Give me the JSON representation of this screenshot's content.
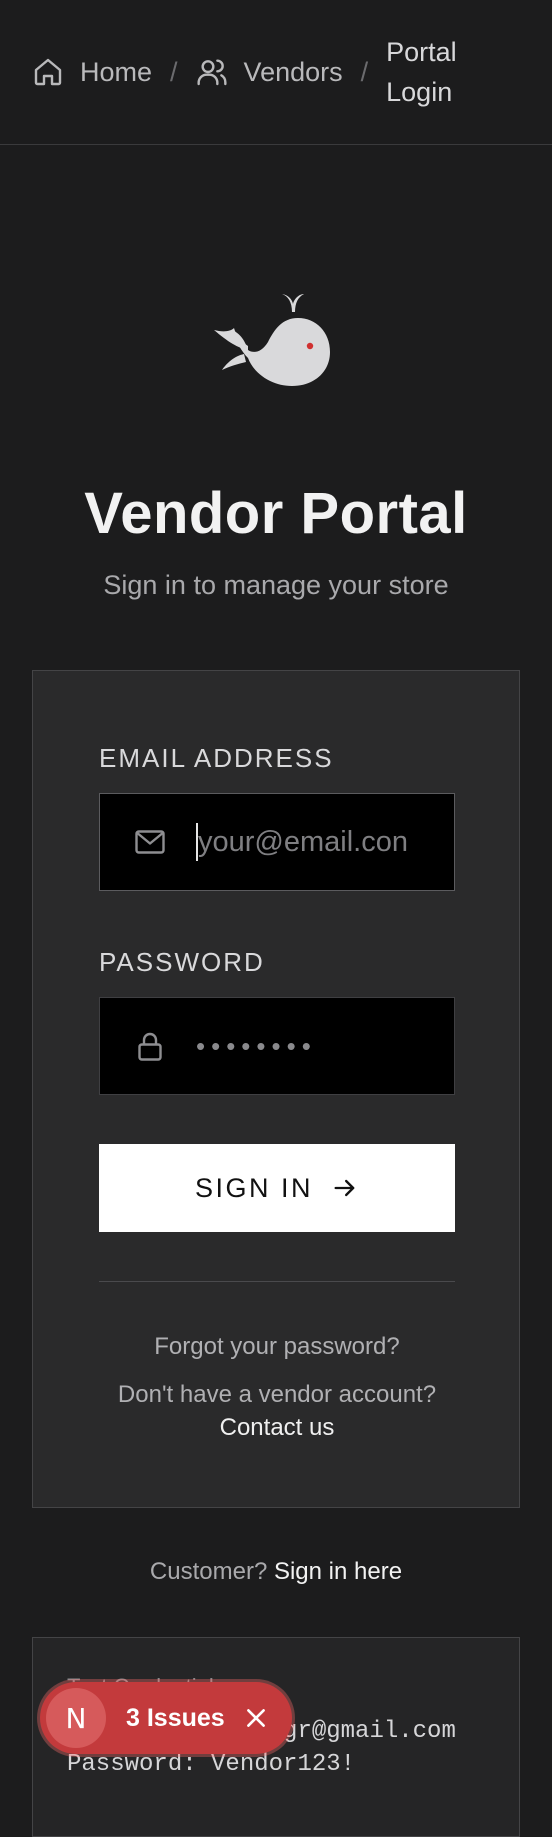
{
  "breadcrumb": {
    "items": [
      {
        "label": "Home",
        "icon": "home-icon"
      },
      {
        "label": "Vendors",
        "icon": "users-icon"
      },
      {
        "label": "Portal Login"
      }
    ],
    "separator": "/"
  },
  "header": {
    "title": "Vendor Portal",
    "subtitle": "Sign in to manage your store",
    "logo": "whale-logo"
  },
  "form": {
    "email_label": "EMAIL ADDRESS",
    "email_placeholder": "your@email.con",
    "email_icon": "mail-icon",
    "password_label": "PASSWORD",
    "password_value": "••••••••",
    "password_icon": "lock-icon",
    "submit_label": "SIGN IN",
    "forgot_label": "Forgot your password?",
    "no_account_text": "Don't have a vendor account?",
    "contact_label": "Contact us"
  },
  "customer": {
    "prompt": "Customer?",
    "link": "Sign in here"
  },
  "test_credentials": {
    "heading": "Test Credentials",
    "email_line": "Email: vendor.mgr@gmail.com",
    "password_line": "Password: Vendor123!"
  },
  "issues_badge": {
    "initial": "N",
    "label": "3 Issues"
  },
  "colors": {
    "background": "#1c1c1d",
    "card": "#2a2a2b",
    "button": "#ffffff",
    "issues": "#c33a3c",
    "whale_eye": "#d03030"
  }
}
